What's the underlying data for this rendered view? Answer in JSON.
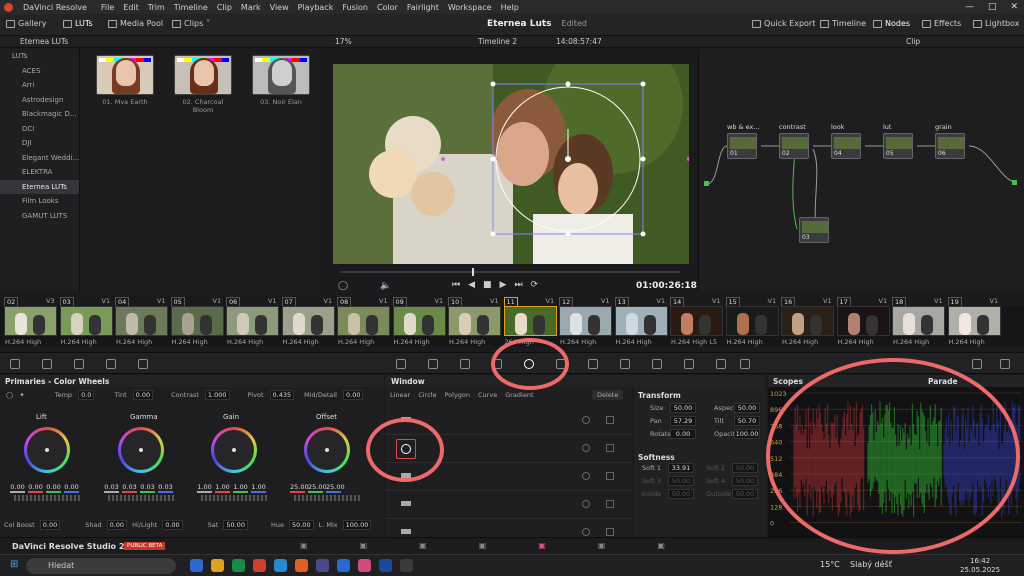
{
  "app": {
    "title": "DaVinci Resolve",
    "menus": [
      "File",
      "Edit",
      "Trim",
      "Timeline",
      "Clip",
      "Mark",
      "View",
      "Playback",
      "Fusion",
      "Color",
      "Fairlight",
      "Workspace",
      "Help"
    ]
  },
  "toolbar": {
    "gallery": "Gallery",
    "luts": "LUTs",
    "media_pool": "Media Pool",
    "clips": "Clips",
    "project": "Eternea Luts",
    "edited": "Edited",
    "quick_export": "Quick Export",
    "timeline": "Timeline",
    "nodes": "Nodes",
    "effects": "Effects",
    "lightbox": "Lightbox"
  },
  "viewer_bar": {
    "folder": "Eternea LUTs",
    "zoom": "17%",
    "timeline": "Timeline 2",
    "timecode": "14:08:57:47",
    "clip": "Clip"
  },
  "lut_folders": [
    {
      "label": "LUTs",
      "selected": false
    },
    {
      "label": "ACES",
      "selected": false
    },
    {
      "label": "Arri",
      "selected": false
    },
    {
      "label": "Astrodesign",
      "selected": false
    },
    {
      "label": "Blackmagic D...",
      "selected": false
    },
    {
      "label": "DCI",
      "selected": false
    },
    {
      "label": "DJI",
      "selected": false
    },
    {
      "label": "Elegant Weddi...",
      "selected": false
    },
    {
      "label": "ELEKTRA",
      "selected": false
    },
    {
      "label": "Eternea LUTs",
      "selected": true
    },
    {
      "label": "Film Looks",
      "selected": false
    },
    {
      "label": "GAMUT LUTS",
      "selected": false
    }
  ],
  "lut_thumbs": [
    "01. Mva Earth",
    "02. Charcoal Bloom",
    "03. Noir Elan"
  ],
  "transport": {
    "timecode": "01:00:26:18"
  },
  "nodes": [
    {
      "label": "wb & ex...",
      "num": "01"
    },
    {
      "label": "contrast",
      "num": "02"
    },
    {
      "label": "look",
      "num": "04"
    },
    {
      "label": "lut",
      "num": "05"
    },
    {
      "label": "grain",
      "num": "06"
    },
    {
      "label": "",
      "num": "03"
    }
  ],
  "clips": [
    {
      "num": "02",
      "track": "V3",
      "label": "H.264 High"
    },
    {
      "num": "03",
      "track": "V1",
      "label": "H.264 High"
    },
    {
      "num": "04",
      "track": "V1",
      "label": "H.264 High"
    },
    {
      "num": "05",
      "track": "V1",
      "label": "H.264 High"
    },
    {
      "num": "06",
      "track": "V1",
      "label": "H.264 High"
    },
    {
      "num": "07",
      "track": "V1",
      "label": "H.264 High"
    },
    {
      "num": "08",
      "track": "V1",
      "label": "H.264 High"
    },
    {
      "num": "09",
      "track": "V1",
      "label": "H.264 High"
    },
    {
      "num": "10",
      "track": "V1",
      "label": "H.264 High"
    },
    {
      "num": "11",
      "track": "V1",
      "label": "264 High"
    },
    {
      "num": "12",
      "track": "V1",
      "label": "H.264 High"
    },
    {
      "num": "13",
      "track": "V1",
      "label": "H.264 High"
    },
    {
      "num": "14",
      "track": "V1",
      "label": "H.264 High L5"
    },
    {
      "num": "15",
      "track": "V1",
      "label": "H.264 High"
    },
    {
      "num": "16",
      "track": "V1",
      "label": "H.264 High"
    },
    {
      "num": "17",
      "track": "V1",
      "label": "H.264 High"
    },
    {
      "num": "18",
      "track": "V1",
      "label": "H.264 High"
    },
    {
      "num": "19",
      "track": "V1",
      "label": "H.264 High"
    }
  ],
  "primaries": {
    "title": "Primaries - Color Wheels",
    "temp_label": "Temp",
    "temp": "0.0",
    "tint_label": "Tint",
    "tint": "0.00",
    "contrast_label": "Contrast",
    "contrast": "1.000",
    "pivot_label": "Pivot",
    "pivot": "0.435",
    "middetail_label": "Mid/Detail",
    "middetail": "0.00",
    "wheels": [
      {
        "name": "Lift",
        "values": [
          "0.00",
          "0.00",
          "0.00",
          "0.00"
        ]
      },
      {
        "name": "Gamma",
        "values": [
          "0.03",
          "0.03",
          "0.03",
          "0.03"
        ]
      },
      {
        "name": "Gain",
        "values": [
          "1.00",
          "1.00",
          "1.00",
          "1.00"
        ]
      },
      {
        "name": "Offset",
        "values": [
          "25.00",
          "25.00",
          "25.00"
        ]
      }
    ],
    "colboost_label": "Col Boost",
    "colboost": "0.00",
    "shad_label": "Shad",
    "shad": "0.00",
    "hilight_label": "Hi/Light",
    "hilight": "0.00",
    "sat_label": "Sat",
    "sat": "50.00",
    "hue_label": "Hue",
    "hue": "50.00",
    "lmix_label": "L. Mix",
    "lmix": "100.00"
  },
  "window": {
    "title": "Window",
    "tools": [
      "Linear",
      "Circle",
      "Polygon",
      "Curve",
      "Gradient"
    ],
    "delete": "Delete"
  },
  "transform": {
    "title": "Transform",
    "size_label": "Size",
    "size": "50.00",
    "aspect_label": "Aspect",
    "aspect": "50.00",
    "pan_label": "Pan",
    "pan": "57.29",
    "tilt_label": "Tilt",
    "tilt": "50.70",
    "rotate_label": "Rotate",
    "rotate": "0.00",
    "opacity_label": "Opacity",
    "opacity": "100.00",
    "softness_title": "Softness",
    "soft1_label": "Soft 1",
    "soft1": "33.91",
    "soft2_label": "Soft 2",
    "soft2": "50.00",
    "soft3_label": "Soft 3",
    "soft3": "50.00",
    "soft4_label": "Soft 4",
    "soft4": "50.00",
    "inside_label": "Inside",
    "inside": "50.00",
    "outside_label": "Outside",
    "outside": "50.00"
  },
  "scopes": {
    "title": "Scopes",
    "mode": "Parade",
    "ticks": [
      "1023",
      "896",
      "768",
      "640",
      "512",
      "384",
      "256",
      "128",
      "0"
    ]
  },
  "footer": {
    "app": "DaVinci Resolve Studio 20",
    "badge": "PUBLIC BETA"
  },
  "taskbar": {
    "search": "Hledat",
    "weather_temp": "15°C",
    "weather_text": "Slabý déšť",
    "time": "16:42",
    "date": "25.05.2025"
  }
}
